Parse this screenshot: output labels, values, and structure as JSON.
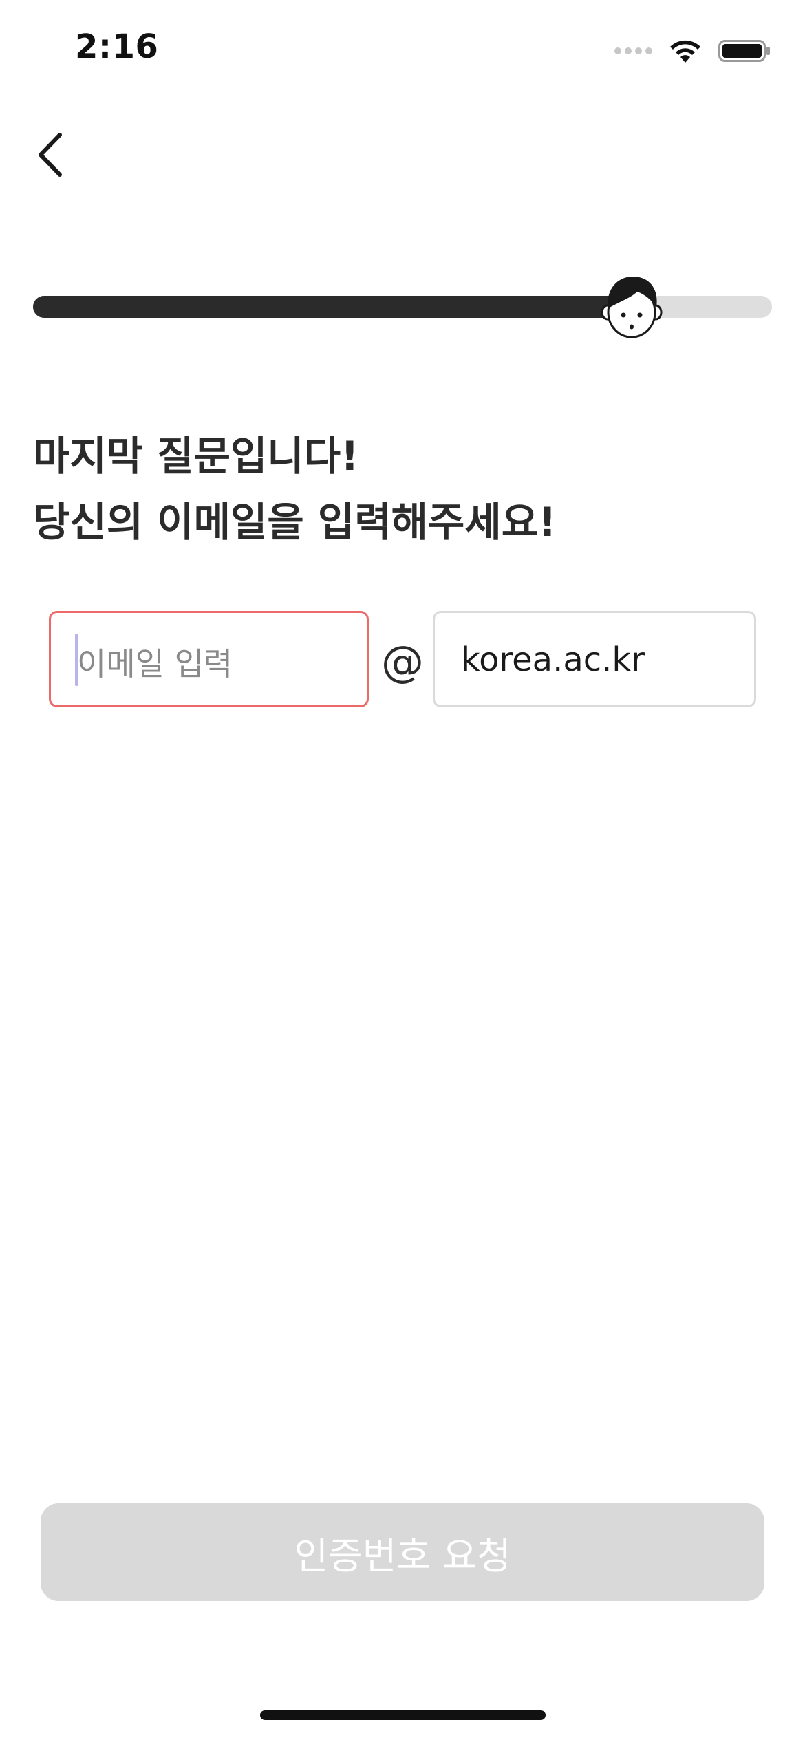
{
  "status_bar": {
    "time": "2:16",
    "wifi_icon": "wifi-icon",
    "battery_icon": "battery-icon"
  },
  "nav": {
    "back_icon": "chevron-left-icon"
  },
  "progress": {
    "fraction": 0.81,
    "avatar_icon": "boy-face-icon",
    "fill_color": "#2b2b2b",
    "track_color": "#dedede"
  },
  "title": {
    "line1": "마지막 질문입니다!",
    "line2": "당신의 이메일을 입력해주세요!"
  },
  "email": {
    "placeholder": "이메일 입력",
    "value": "",
    "border_color": "#ec6a6a",
    "at_sign": "@",
    "domain": "korea.ac.kr"
  },
  "request_button": {
    "label": "인증번호 요청",
    "disabled": true,
    "background": "#d9d9d9"
  }
}
